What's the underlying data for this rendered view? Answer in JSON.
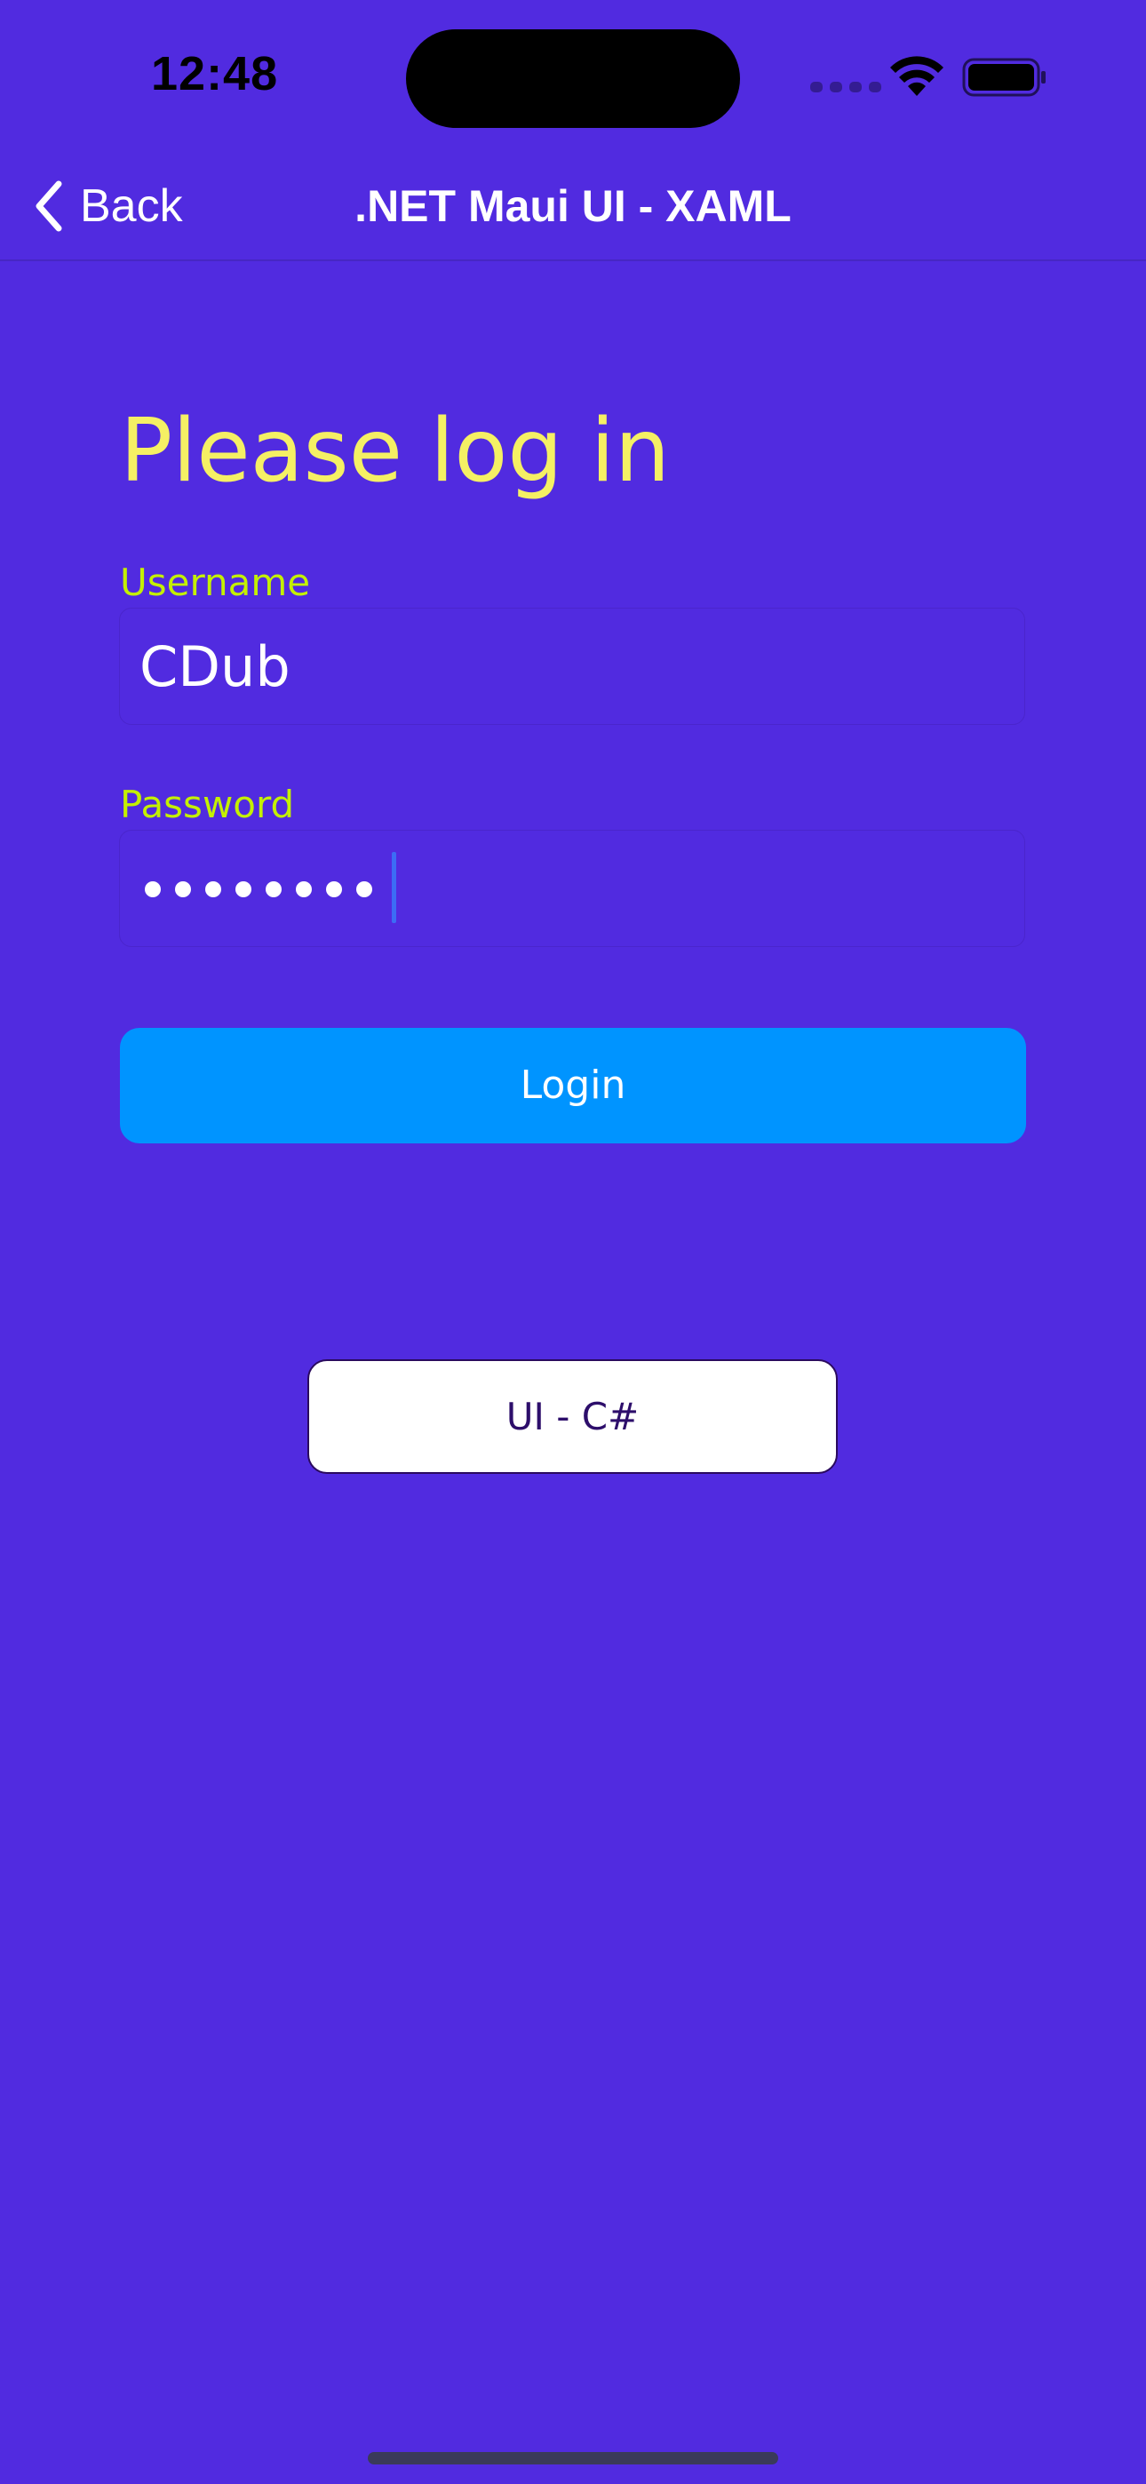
{
  "status_bar": {
    "time": "12:48"
  },
  "nav": {
    "back_label": "Back",
    "title": ".NET Maui UI - XAML"
  },
  "form": {
    "heading": "Please log in",
    "username_label": "Username",
    "username_value": "CDub",
    "password_label": "Password",
    "password_masked": "••••••••",
    "login_label": "Login"
  },
  "alt_button_label": "UI - C#",
  "colors": {
    "background": "#512BE0",
    "heading": "#F5F064",
    "field_label": "#C4F000",
    "login_button": "#0094FF",
    "alt_button": "#FFFFFF"
  }
}
